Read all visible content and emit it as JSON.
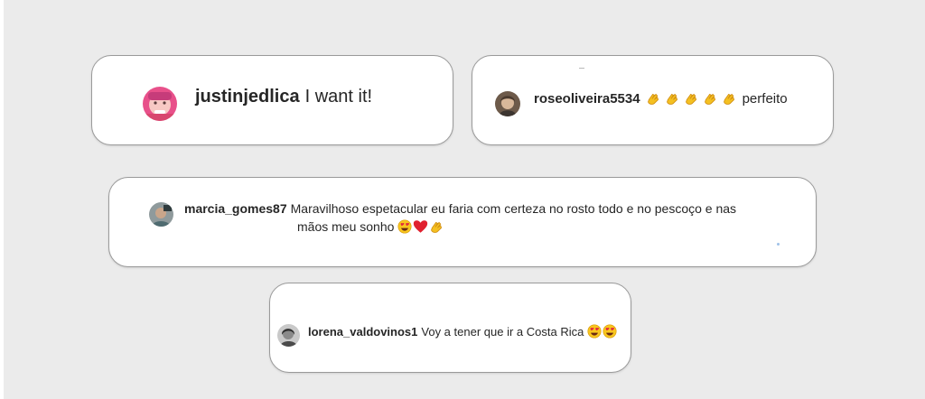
{
  "comments": [
    {
      "username": "justinjedlica",
      "text": "I want it!",
      "avatar_icon": "user-avatar-photo"
    },
    {
      "username": "roseoliveira5534",
      "emojis": "👏👏👏👏👏",
      "text": "perfeito",
      "avatar_icon": "user-avatar-photo"
    },
    {
      "username": "marcia_gomes87",
      "text_line1": "Maravilhoso espetacular eu faria com certeza no rosto todo e no pescoço e nas",
      "text_line2": "mãos meu sonho",
      "emojis": "😍❤️👏",
      "avatar_icon": "user-avatar-photo"
    },
    {
      "username": "lorena_valdovinos1",
      "text": "Voy a tener que ir a Costa Rica",
      "emojis": "😍😍",
      "avatar_icon": "user-avatar-photo"
    }
  ],
  "colors": {
    "background": "#ebebeb",
    "card": "#ffffff",
    "card_border": "#9a9a9a",
    "text": "#262626"
  }
}
